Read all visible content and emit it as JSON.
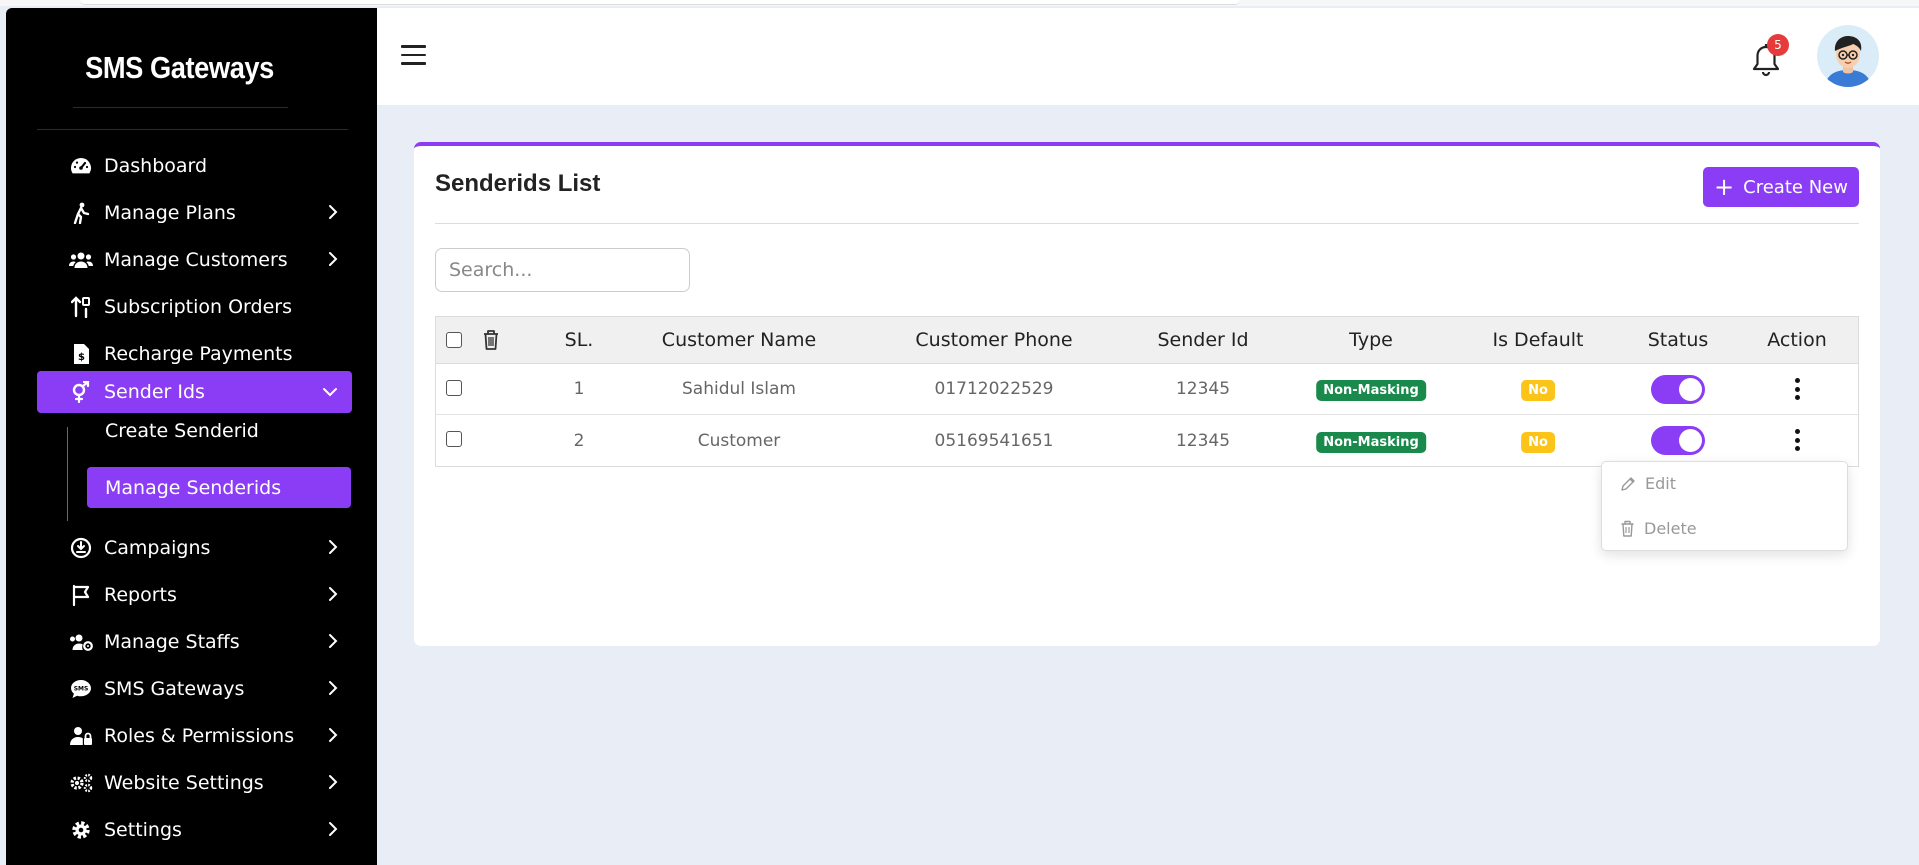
{
  "app": {
    "brand": "SMS Gateways"
  },
  "sidebar": {
    "items": [
      {
        "label": "Dashboard",
        "icon": "gauge-icon"
      },
      {
        "label": "Manage Plans",
        "icon": "walking-icon"
      },
      {
        "label": "Manage Customers",
        "icon": "users-icon"
      },
      {
        "label": "Subscription Orders",
        "icon": "sort-icon"
      },
      {
        "label": "Recharge Payments",
        "icon": "invoice-dollar-icon"
      },
      {
        "label": "Sender Ids",
        "icon": "gender-icon"
      },
      {
        "label": "Campaigns",
        "icon": "campaign-icon"
      },
      {
        "label": "Reports",
        "icon": "flag-icon"
      },
      {
        "label": "Manage Staffs",
        "icon": "users-gear-icon"
      },
      {
        "label": "SMS Gateways",
        "icon": "sms-icon"
      },
      {
        "label": "Roles & Permissions",
        "icon": "user-lock-icon"
      },
      {
        "label": "Website Settings",
        "icon": "gears-icon"
      },
      {
        "label": "Settings",
        "icon": "gear-icon"
      }
    ],
    "submenu": [
      {
        "label": "Create Senderid"
      },
      {
        "label": "Manage Senderids"
      }
    ],
    "active": "Sender Ids",
    "active_sub": "Manage Senderids",
    "accent": "#8b3df5"
  },
  "header": {
    "notification_count": "5"
  },
  "page": {
    "title": "Senderids List",
    "create_label": "Create New",
    "search_placeholder": "Search..."
  },
  "table": {
    "columns": [
      "SL.",
      "Customer Name",
      "Customer Phone",
      "Sender Id",
      "Type",
      "Is Default",
      "Status",
      "Action"
    ],
    "rows": [
      {
        "sl": "1",
        "customer_name": "Sahidul Islam",
        "customer_phone": "01712022529",
        "sender_id": "12345",
        "type": "Non-Masking",
        "is_default": "No",
        "status_on": true
      },
      {
        "sl": "2",
        "customer_name": "Customer",
        "customer_phone": "05169541651",
        "sender_id": "12345",
        "type": "Non-Masking",
        "is_default": "No",
        "status_on": true
      }
    ]
  },
  "action_menu": {
    "edit_label": "Edit",
    "delete_label": "Delete"
  }
}
